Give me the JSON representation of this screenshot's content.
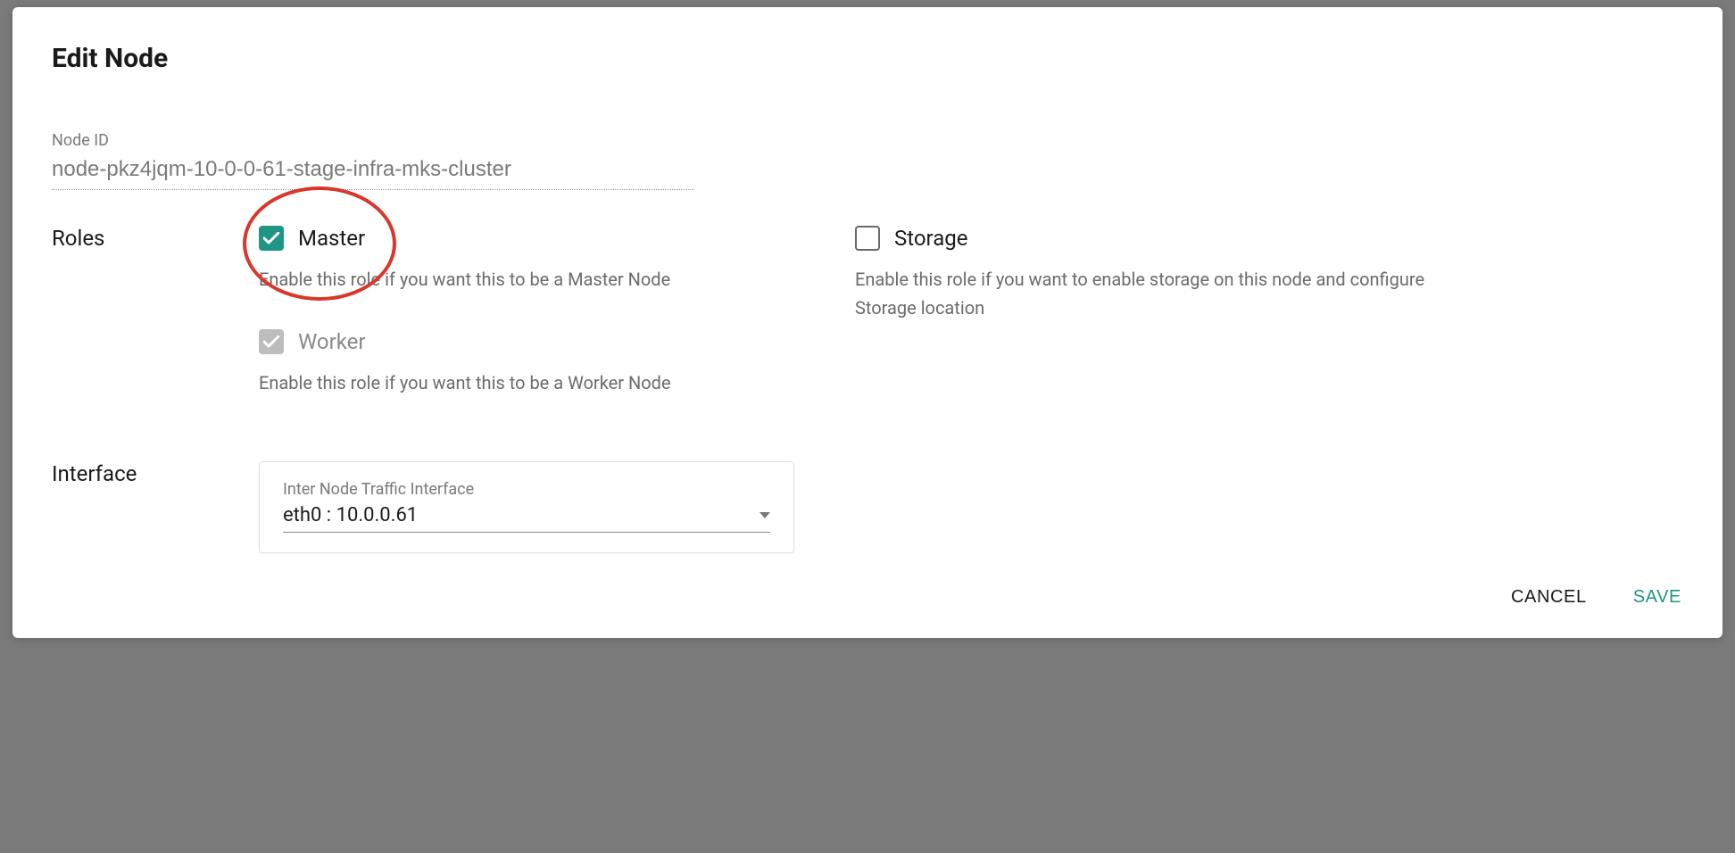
{
  "dialog": {
    "title": "Edit Node"
  },
  "node_id": {
    "label": "Node ID",
    "value": "node-pkz4jqm-10-0-0-61-stage-infra-mks-cluster"
  },
  "roles_section": {
    "label": "Roles",
    "master": {
      "label": "Master",
      "helper": "Enable this role if you want this to be a Master Node",
      "checked": true,
      "disabled": false
    },
    "worker": {
      "label": "Worker",
      "helper": "Enable this role if you want this to be a Worker Node",
      "checked": true,
      "disabled": true
    },
    "storage": {
      "label": "Storage",
      "helper": "Enable this role if you want to enable storage on this node and configure Storage location",
      "checked": false,
      "disabled": false
    }
  },
  "interface_section": {
    "label": "Interface",
    "select": {
      "label": "Inter Node Traffic Interface",
      "value": "eth0 : 10.0.0.61"
    }
  },
  "actions": {
    "cancel": "CANCEL",
    "save": "SAVE"
  },
  "colors": {
    "accent": "#1f9585",
    "highlight": "#d9362c"
  }
}
